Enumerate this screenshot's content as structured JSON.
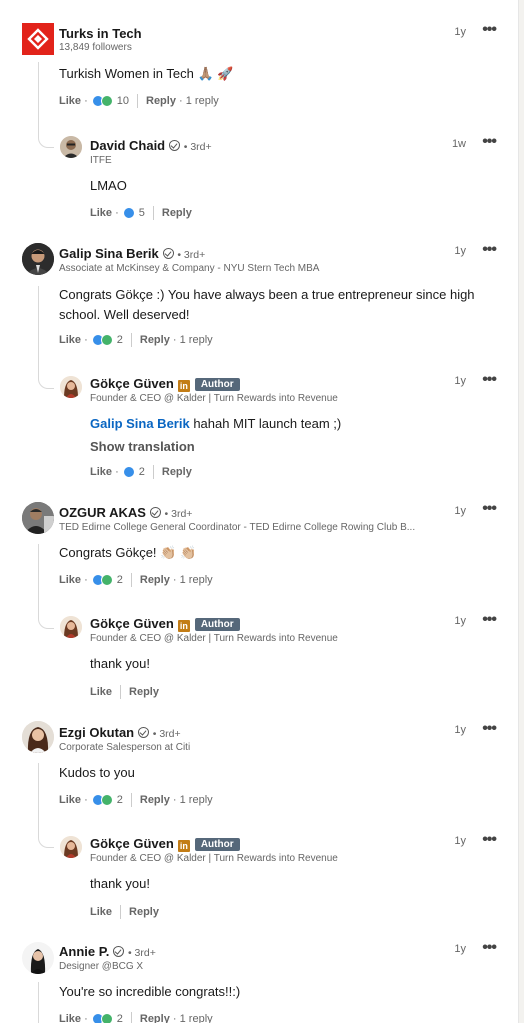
{
  "comments": [
    {
      "id": "c1",
      "name": "Turks in Tech",
      "subtitle": "13,849 followers",
      "time": "1y",
      "text": "Turkish Women in Tech 🙏🏽 🚀",
      "like": "Like",
      "reactions": "10",
      "reply": "Reply",
      "replies": "1 reply",
      "reply_item": {
        "name": "David Chaid",
        "degree": "• 3rd+",
        "subtitle": "ITFE",
        "time": "1w",
        "text": "LMAO",
        "like": "Like",
        "reactions": "5",
        "reply": "Reply"
      }
    },
    {
      "id": "c2",
      "name": "Galip Sina Berik",
      "degree": "• 3rd+",
      "subtitle": "Associate at McKinsey & Company - NYU Stern Tech MBA",
      "time": "1y",
      "text": "Congrats Gökçe :) You have always been a true entrepreneur since high school. Well deserved!",
      "like": "Like",
      "reactions": "2",
      "reply": "Reply",
      "replies": "1 reply",
      "reply_item": {
        "name": "Gökçe Güven",
        "badge": "Author",
        "subtitle": "Founder & CEO @ Kalder | Turn Rewards into Revenue",
        "time": "1y",
        "mention": "Galip Sina Berik",
        "text": "hahah MIT launch team ;)",
        "translation": "Show translation",
        "like": "Like",
        "reactions": "2",
        "reply": "Reply"
      }
    },
    {
      "id": "c3",
      "name": "OZGUR AKAS",
      "degree": "• 3rd+",
      "subtitle": "TED Edirne College General Coordinator - TED Edirne College Rowing Club B...",
      "time": "1y",
      "text": "Congrats Gökçe! 👏🏼 👏🏼",
      "like": "Like",
      "reactions": "2",
      "reply": "Reply",
      "replies": "1 reply",
      "reply_item": {
        "name": "Gökçe Güven",
        "badge": "Author",
        "subtitle": "Founder & CEO @ Kalder | Turn Rewards into Revenue",
        "time": "1y",
        "text": "thank you!",
        "like": "Like",
        "reply": "Reply"
      }
    },
    {
      "id": "c4",
      "name": "Ezgi Okutan",
      "degree": "• 3rd+",
      "subtitle": "Corporate Salesperson at Citi",
      "time": "1y",
      "text": "Kudos to you",
      "like": "Like",
      "reactions": "2",
      "reply": "Reply",
      "replies": "1 reply",
      "reply_item": {
        "name": "Gökçe Güven",
        "badge": "Author",
        "subtitle": "Founder & CEO @ Kalder | Turn Rewards into Revenue",
        "time": "1y",
        "text": "thank you!",
        "like": "Like",
        "reply": "Reply"
      }
    },
    {
      "id": "c5",
      "name": "Annie P.",
      "degree": "• 3rd+",
      "subtitle": "Designer @BCG X",
      "time": "1y",
      "text": "You're so incredible congrats!!:)",
      "like": "Like",
      "reactions": "2",
      "reply": "Reply",
      "replies": "1 reply"
    }
  ],
  "colors": {
    "link": "#0a66c2",
    "author_badge": "#56687a",
    "in_badge": "#c37d16",
    "turks_logo": "#e2231a"
  },
  "icons": [
    "turks-in-tech-logo",
    "verified-icon",
    "linkedin-premium-icon",
    "more-options-icon",
    "like-reaction-icon",
    "celebrate-reaction-icon"
  ]
}
